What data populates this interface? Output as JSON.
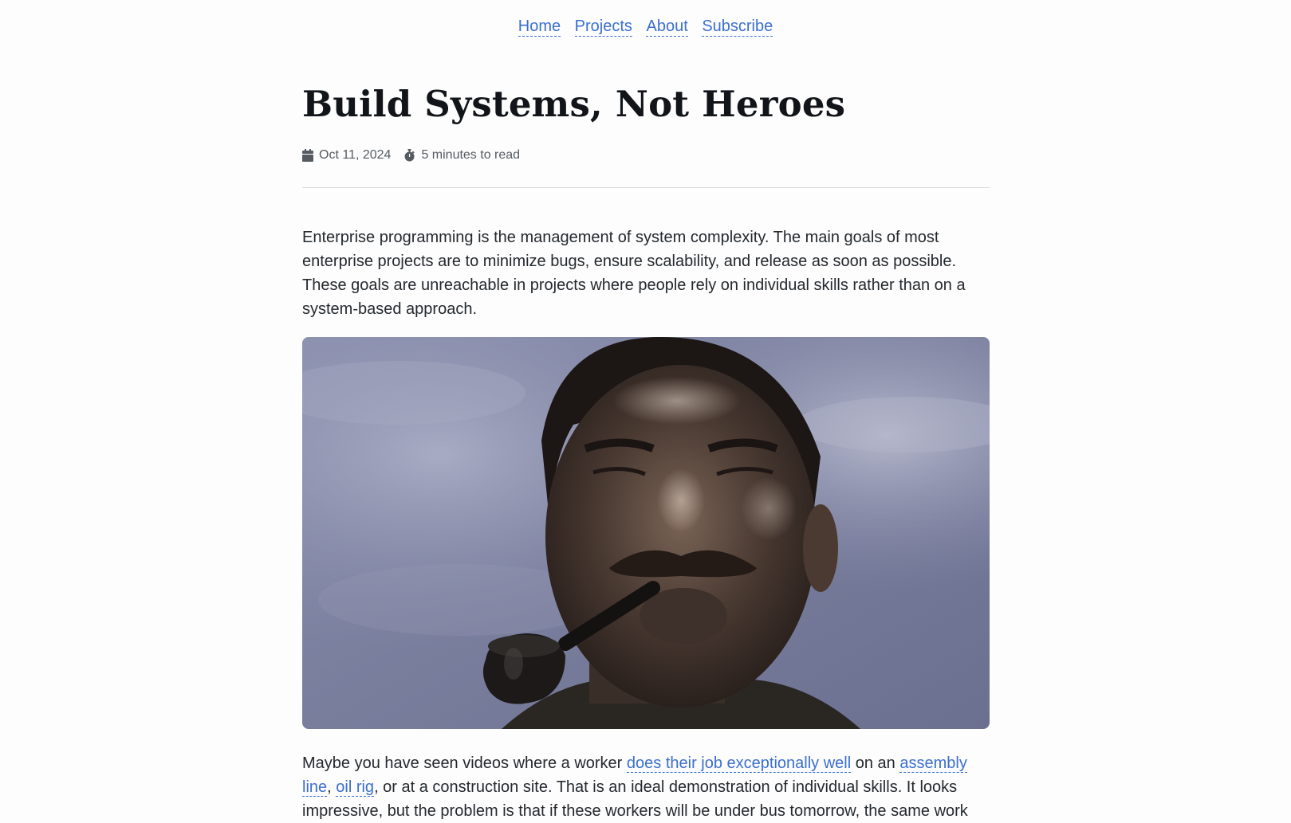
{
  "nav": {
    "items": [
      {
        "label": "Home"
      },
      {
        "label": "Projects"
      },
      {
        "label": "About"
      },
      {
        "label": "Subscribe"
      }
    ]
  },
  "post": {
    "title": "Build Systems, Not Heroes",
    "date": "Oct 11, 2024",
    "reading_time": "5 minutes to read",
    "intro": "Enterprise programming is the management of system complexity. The main goals of most enterprise projects are to minimize bugs, ensure scalability, and release as soon as possible. These goals are unreachable in projects where people rely on individual skills rather than on a system-based approach.",
    "body": {
      "part1": "Maybe you have seen videos where a worker ",
      "link1": "does their job exceptionally well",
      "part2": " on an ",
      "link2": "assembly line",
      "part3": ", ",
      "link3": "oil rig",
      "part4": ", or at a construction site. That is an ideal demonstration of individual skills. It looks impressive, but the problem is that if these workers will be under bus tomorrow, the same work"
    }
  },
  "icons": {
    "date": "calendar-icon",
    "reading_time": "stopwatch-icon"
  },
  "colors": {
    "link": "#3b6fcf",
    "text": "#24292e",
    "meta": "#555b61",
    "background": "#fdfdfd"
  }
}
